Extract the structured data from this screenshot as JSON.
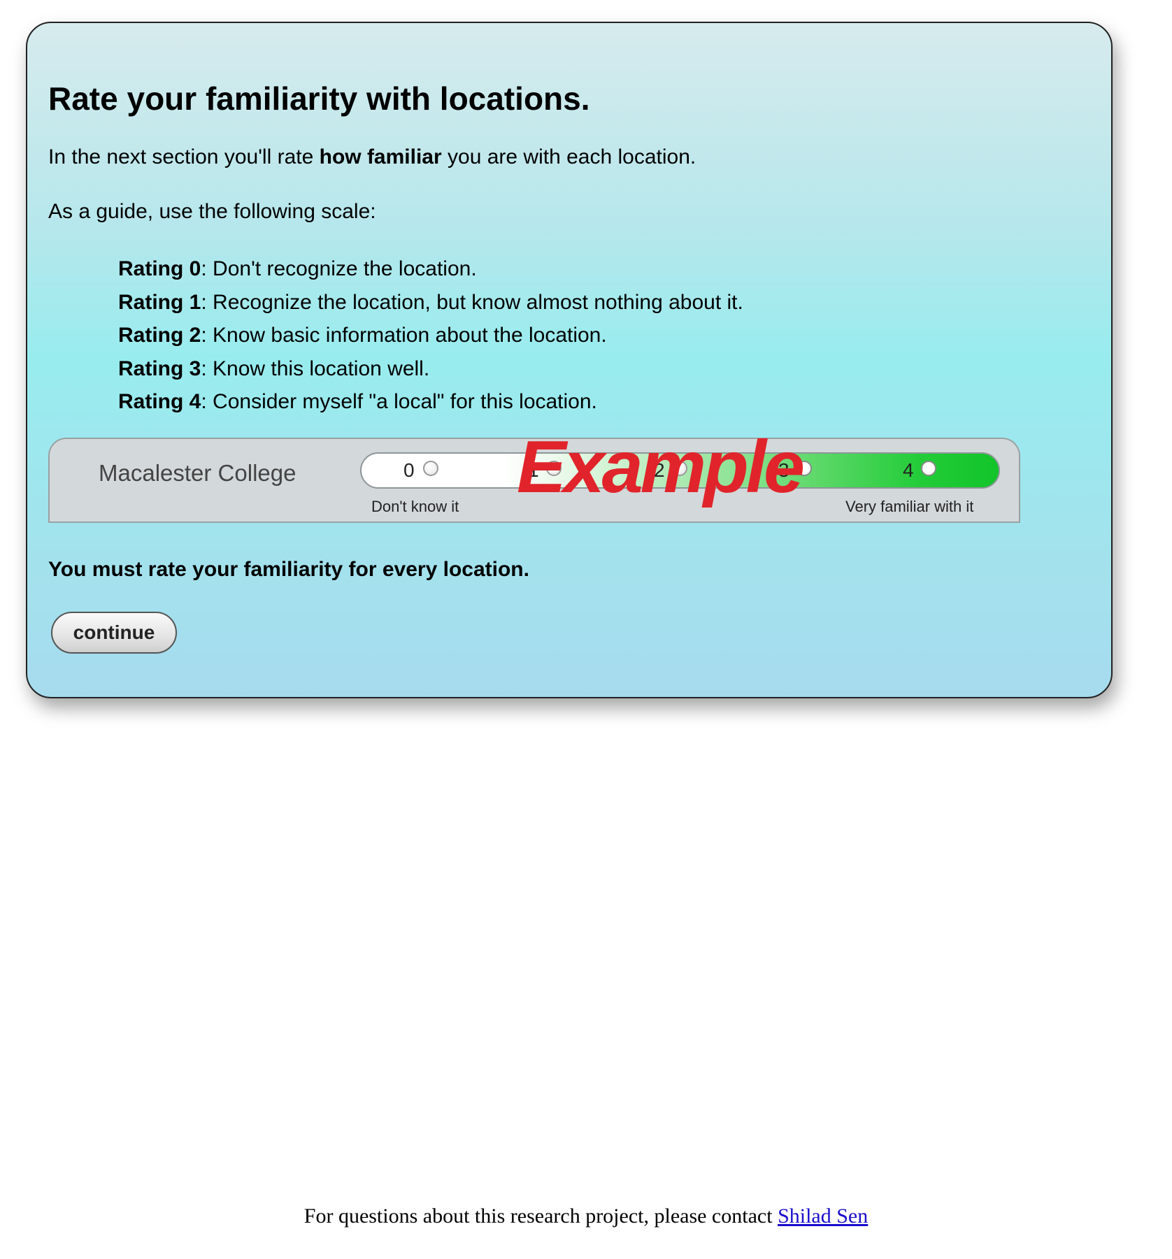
{
  "panel": {
    "title": "Rate your familiarity with locations.",
    "intro": {
      "before": "In the next section you'll rate ",
      "bold": "how familiar",
      "after": " you are with each location."
    },
    "guide_text": "As a guide, use the following scale:",
    "scale": [
      {
        "label": "Rating 0",
        "text": ": Don't recognize the location."
      },
      {
        "label": "Rating 1",
        "text": ": Recognize the location, but know almost nothing about it."
      },
      {
        "label": "Rating 2",
        "text": ": Know basic information about the location."
      },
      {
        "label": "Rating 3",
        "text": ": Know this location well."
      },
      {
        "label": "Rating 4",
        "text": ": Consider myself \"a local\" for this location."
      }
    ],
    "example": {
      "location": "Macalester College",
      "ticks": [
        "0",
        "1",
        "2",
        "3",
        "4"
      ],
      "low_label": "Don't know it",
      "high_label": "Very familiar with it",
      "watermark": "Example",
      "watermark_color": "#e1242b"
    },
    "requirement": "You must rate your familiarity for every location.",
    "continue_label": "continue"
  },
  "footer": {
    "text": "For questions about this research project, please contact ",
    "link_text": "Shilad Sen"
  },
  "colors": {
    "link": "#1a0dcc",
    "slider_high": "#12c42a"
  }
}
